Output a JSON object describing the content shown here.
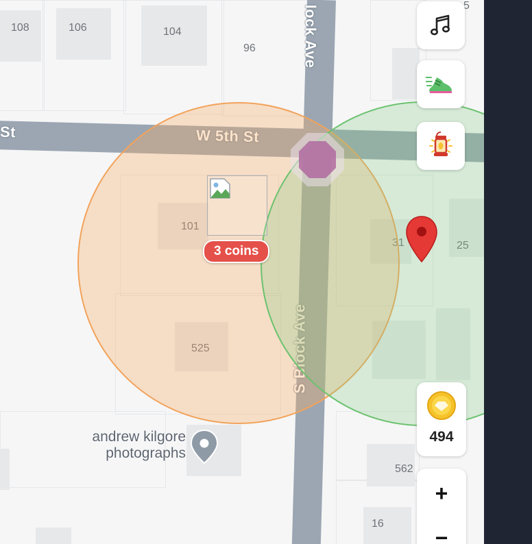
{
  "map": {
    "streets": {
      "horizontal": "W 5th St",
      "horizontal_left_fragment": "St",
      "vertical": "S Block Ave",
      "vertical_top_fragment": "lock Ave"
    },
    "house_numbers": {
      "n108": "108",
      "n106": "106",
      "n104": "104",
      "n96": "96",
      "n101": "101",
      "n525": "525",
      "n31": "31",
      "n25": "25",
      "n562": "562",
      "n16": "16",
      "n_top_right": "5"
    },
    "poi": {
      "name_line1": "andrew kilgore",
      "name_line2": "photographs",
      "icon": "map-pin-icon"
    },
    "coins_badge": "3 coins",
    "orange_zone_color": "#f2a35b",
    "green_zone_color": "#6cc26f",
    "marker_color": "#e53935"
  },
  "controls": {
    "music_icon": "music-note-icon",
    "shoe_icon": "running-shoe-icon",
    "lantern_icon": "lantern-icon",
    "coin_count": "494",
    "coin_icon": "coin-icon",
    "zoom_in": "+",
    "zoom_out": "−"
  }
}
